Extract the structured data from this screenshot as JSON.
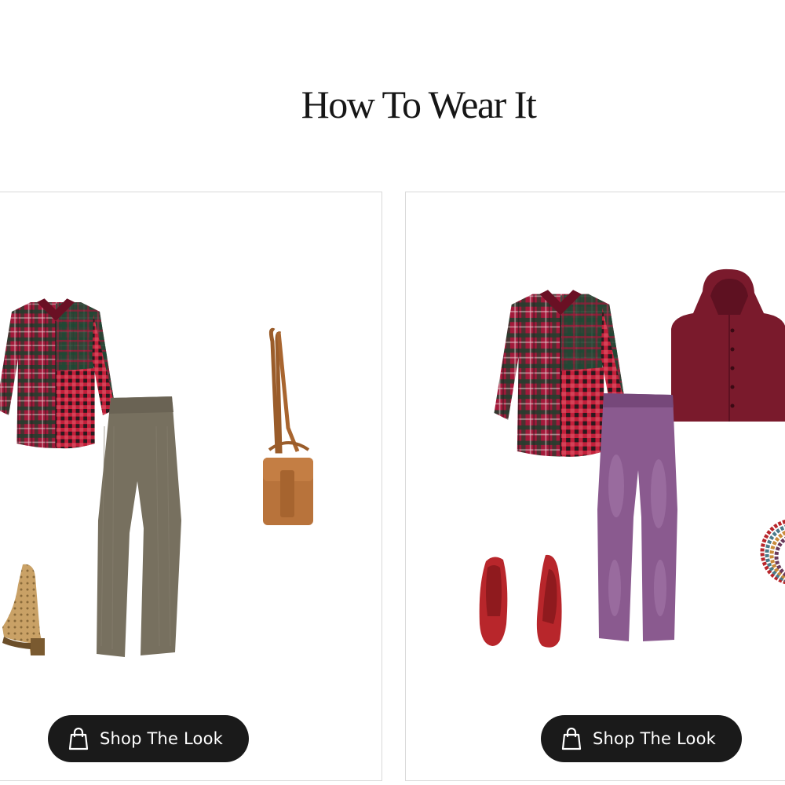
{
  "section": {
    "title": "How To Wear It"
  },
  "looks": [
    {
      "items": [
        "plaid-tunic-icon",
        "corduroy-pants-icon",
        "crossbody-bag-icon",
        "perforated-bootie-icon"
      ],
      "shop_label": "Shop The Look",
      "shop_icon": "shopping-bag-icon"
    },
    {
      "items": [
        "plaid-tunic-icon",
        "hooded-vest-icon",
        "purple-jeans-icon",
        "red-flats-icon",
        "beaded-necklace-icon"
      ],
      "shop_label": "Shop The Look",
      "shop_icon": "shopping-bag-icon"
    }
  ],
  "colors": {
    "button_bg": "#1a1a1a",
    "button_text": "#ffffff",
    "card_border": "#d9d9d9",
    "plaid_red": "#9e1b32",
    "plaid_green": "#1f3d2b",
    "pants_taupe": "#77705f",
    "bag_tan": "#b8733b",
    "vest_burgundy": "#7a1a2c",
    "jeans_purple": "#8a5a8f",
    "flats_red": "#b8262b"
  }
}
